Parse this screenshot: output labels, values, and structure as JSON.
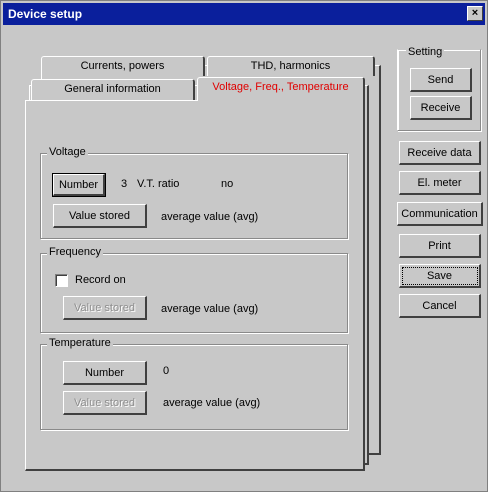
{
  "window": {
    "title": "Device setup",
    "close_label": "×"
  },
  "tabs": {
    "row_back": [
      {
        "label": "Currents, powers"
      },
      {
        "label": "THD, harmonics"
      }
    ],
    "row_front": [
      {
        "label": "General information"
      },
      {
        "label": "Voltage, Freq., Temperature"
      }
    ],
    "active_color": "#e00000"
  },
  "voltage": {
    "legend": "Voltage",
    "number_button": "Number",
    "number_value": "3",
    "vt_label": "V.T. ratio",
    "vt_value": "no",
    "value_stored_button": "Value stored",
    "value_stored_text": "average value (avg)"
  },
  "frequency": {
    "legend": "Frequency",
    "record_on_label": "Record on",
    "record_on_checked": false,
    "value_stored_button": "Value stored",
    "value_stored_text": "average value (avg)"
  },
  "temperature": {
    "legend": "Temperature",
    "number_button": "Number",
    "number_value": "0",
    "value_stored_button": "Value stored",
    "value_stored_text": "average value (avg)"
  },
  "setting": {
    "legend": "Setting",
    "send_button": "Send",
    "receive_button": "Receive"
  },
  "side_buttons": {
    "receive_data": "Receive data",
    "el_meter": "El. meter",
    "communication": "Communication",
    "print": "Print",
    "save": "Save",
    "cancel": "Cancel"
  }
}
